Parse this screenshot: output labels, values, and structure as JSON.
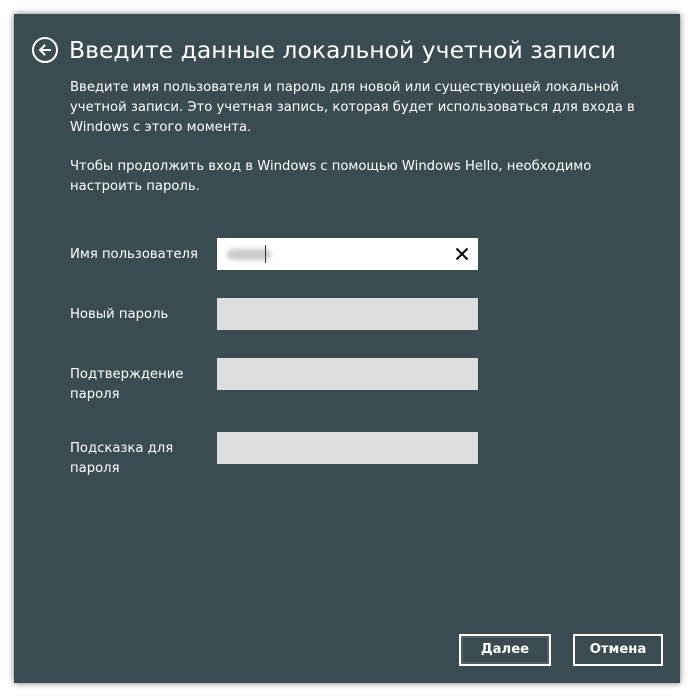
{
  "header": {
    "title": "Введите данные локальной учетной записи",
    "back_icon": "back-arrow-icon"
  },
  "description": {
    "paragraph1": "Введите имя пользователя и пароль для новой или существующей локальной учетной записи. Это учетная запись, которая будет использоваться для входа в Windows с этого момента.",
    "paragraph2": "Чтобы продолжить вход в Windows с помощью Windows Hello, необходимо настроить пароль."
  },
  "form": {
    "username": {
      "label": "Имя пользователя",
      "value": "",
      "clear_icon": "close-icon"
    },
    "new_password": {
      "label": "Новый пароль",
      "value": ""
    },
    "confirm_password": {
      "label": "Подтверждение пароля",
      "value": ""
    },
    "password_hint": {
      "label": "Подсказка для пароля",
      "value": ""
    }
  },
  "buttons": {
    "next_label": "Далее",
    "cancel_label": "Отмена"
  },
  "colors": {
    "window_background": "#3a4b52",
    "input_background": "#dcdedf",
    "active_input_background": "#ffffff",
    "text": "#ffffff"
  }
}
